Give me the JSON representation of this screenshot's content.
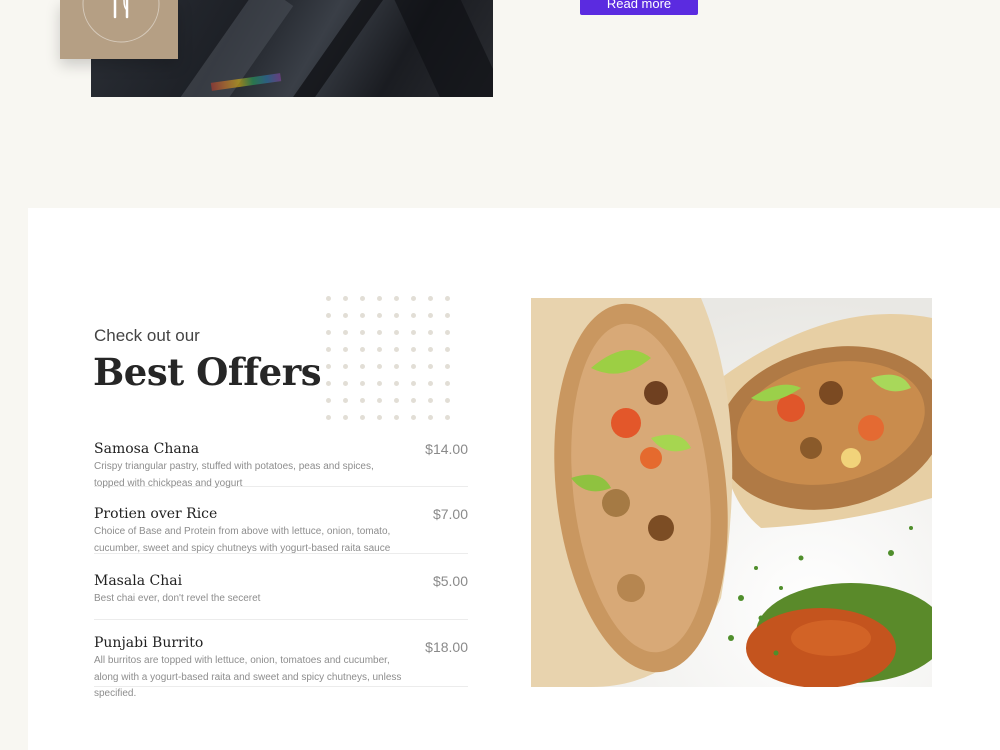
{
  "top": {
    "read_more_label": "Read more",
    "photo_alt": "restaurant interior photo",
    "badge_icon": "fork-knife-icon"
  },
  "offers": {
    "kicker": "Check out our",
    "heading": "Best Offers",
    "items": [
      {
        "name": "Samosa Chana",
        "price": "$14.00",
        "desc": "Crispy triangular pastry, stuffed with potatoes, peas and spices, topped with chickpeas and yogurt"
      },
      {
        "name": "Protien over Rice",
        "price": "$7.00",
        "desc": "Choice of Base and Protein from above with lettuce, onion, tomato, cucumber, sweet and spicy chutneys with yogurt-based raita sauce"
      },
      {
        "name": "Masala Chai",
        "price": "$5.00",
        "desc": "Best chai ever, don't revel the seceret"
      },
      {
        "name": "Punjabi Burrito",
        "price": "$18.00",
        "desc": "All burritos are topped with lettuce, onion, tomatoes and cucumber, along with a yogurt-based raita and sweet and spicy chutneys, unless specified."
      }
    ],
    "photo_alt": "burrito cut in half with chutney"
  },
  "colors": {
    "page_bg": "#f8f7f2",
    "accent_button": "#5b2be0",
    "badge": "#b59f84"
  }
}
